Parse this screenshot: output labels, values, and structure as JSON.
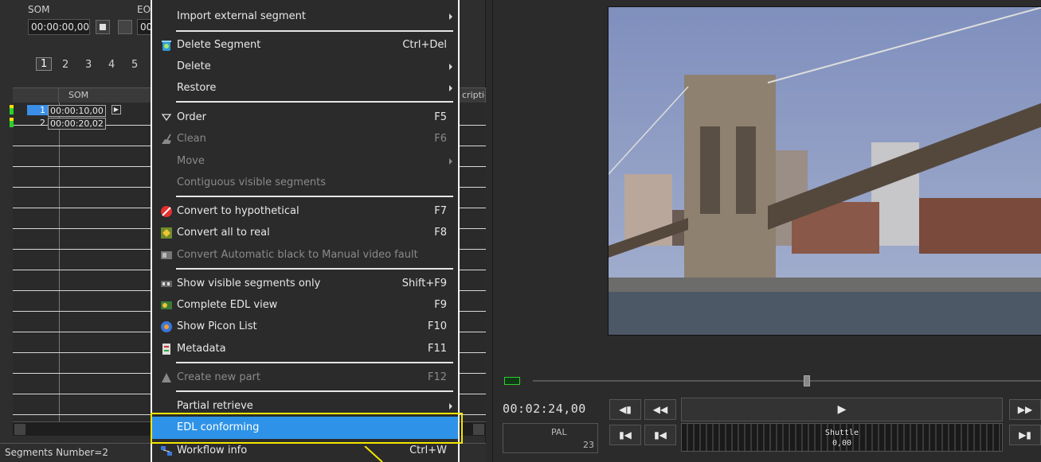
{
  "left_panel": {
    "som_label": "SOM",
    "eom_label": "EO",
    "som_value": "00:00:00,00",
    "eom_value": "00",
    "pages": [
      "1",
      "2",
      "3",
      "4",
      "5"
    ],
    "columns": {
      "som": "SOM",
      "description": "criptic"
    },
    "segments": [
      {
        "index": "1",
        "som": "00:00:10,00"
      },
      {
        "index": "2",
        "som": "00:00:20,02"
      }
    ],
    "status": "Segments Number=2"
  },
  "menu": {
    "items": [
      {
        "label": "Import external segment",
        "shortcut": "",
        "icon": "",
        "submenu": true,
        "disabled": false
      },
      {
        "label": "Delete Segment",
        "shortcut": "Ctrl+Del",
        "icon": "recycle-bin-icon",
        "submenu": false,
        "disabled": false
      },
      {
        "label": "Delete",
        "shortcut": "",
        "icon": "",
        "submenu": true,
        "disabled": false
      },
      {
        "label": "Restore",
        "shortcut": "",
        "icon": "",
        "submenu": true,
        "disabled": false
      },
      {
        "label": "Order",
        "shortcut": "F5",
        "icon": "funnel-icon",
        "submenu": false,
        "disabled": false
      },
      {
        "label": "Clean",
        "shortcut": "F6",
        "icon": "broom-icon",
        "submenu": false,
        "disabled": true
      },
      {
        "label": "Move",
        "shortcut": "",
        "icon": "",
        "submenu": true,
        "disabled": true
      },
      {
        "label": "Contiguous visible segments",
        "shortcut": "",
        "icon": "",
        "submenu": false,
        "disabled": true
      },
      {
        "label": "Convert to hypothetical",
        "shortcut": "F7",
        "icon": "no-entry-icon",
        "submenu": false,
        "disabled": false
      },
      {
        "label": "Convert all to real",
        "shortcut": "F8",
        "icon": "convert-all-icon",
        "submenu": false,
        "disabled": false
      },
      {
        "label": "Convert Automatic black to Manual video fault",
        "shortcut": "",
        "icon": "video-fault-icon",
        "submenu": false,
        "disabled": true
      },
      {
        "label": "Show visible segments only",
        "shortcut": "Shift+F9",
        "icon": "filmstrip-icon",
        "submenu": false,
        "disabled": false
      },
      {
        "label": "Complete EDL view",
        "shortcut": "F9",
        "icon": "edl-view-icon",
        "submenu": false,
        "disabled": false
      },
      {
        "label": "Show Picon List",
        "shortcut": "F10",
        "icon": "picon-icon",
        "submenu": false,
        "disabled": false
      },
      {
        "label": "Metadata",
        "shortcut": "F11",
        "icon": "metadata-icon",
        "submenu": false,
        "disabled": false
      },
      {
        "label": "Create new part",
        "shortcut": "F12",
        "icon": "new-part-icon",
        "submenu": false,
        "disabled": true
      },
      {
        "label": "Partial retrieve",
        "shortcut": "",
        "icon": "",
        "submenu": true,
        "disabled": false
      },
      {
        "label": "EDL conforming",
        "shortcut": "",
        "icon": "",
        "submenu": false,
        "disabled": false,
        "highlighted": true
      },
      {
        "label": "Workflow info",
        "shortcut": "Ctrl+W",
        "icon": "workflow-icon",
        "submenu": false,
        "disabled": false
      }
    ],
    "colors": {
      "highlight": "#2e93e8",
      "annotation": "#f3e600"
    }
  },
  "player": {
    "timecode": "00:02:24,00",
    "format": "PAL",
    "format_sub": "23",
    "play_label": "▶",
    "shuttle_label": "Shuttle",
    "shuttle_value": "0,00",
    "buttons": {
      "prev_frame": "◀▮",
      "rewind": "◀◀",
      "fast_forward": "▶▶",
      "go_start": "▮◀",
      "step_back": "▮◀",
      "go_end": "▶▮"
    },
    "video_description_colors": {
      "sky": "#8a9cc4",
      "water": "#4a5566"
    }
  }
}
